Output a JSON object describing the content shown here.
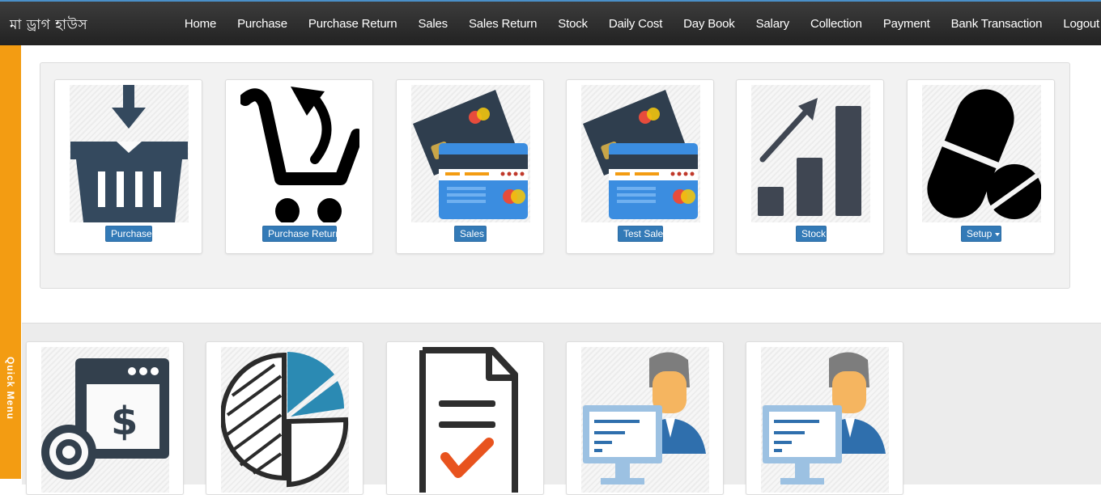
{
  "brand": "মা ড্রাগ হাউস",
  "nav": {
    "home": "Home",
    "purchase": "Purchase",
    "purchase_return": "Purchase Return",
    "sales": "Sales",
    "sales_return": "Sales Return",
    "stock": "Stock",
    "daily_cost": "Daily Cost",
    "day_book": "Day Book",
    "salary": "Salary",
    "collection": "Collection",
    "payment": "Payment",
    "bank_transaction": "Bank Transaction",
    "logout": "Logout"
  },
  "quick_menu": "Quick Menu",
  "tiles": {
    "purchase": "Purchase",
    "purchase_return": "Purchase Return",
    "sales": "Sales",
    "test_sale": "Test Sale",
    "stock": "Stock",
    "setup": "Setup"
  },
  "icons": {
    "purchase": "basket-download-icon",
    "purchase_return": "cart-return-icon",
    "sales": "credit-cards-icon",
    "test_sale": "credit-cards-icon",
    "stock": "growth-chart-icon",
    "setup": "pill-capsule-icon",
    "r2_1": "money-settings-icon",
    "r2_2": "pie-chart-icon",
    "r2_3": "approved-document-icon",
    "r2_4": "user-computer-icon",
    "r2_5": "user-computer-icon"
  },
  "colors": {
    "navbar": "#222222",
    "accent": "#337ab7",
    "quick_menu": "#f39c12"
  }
}
